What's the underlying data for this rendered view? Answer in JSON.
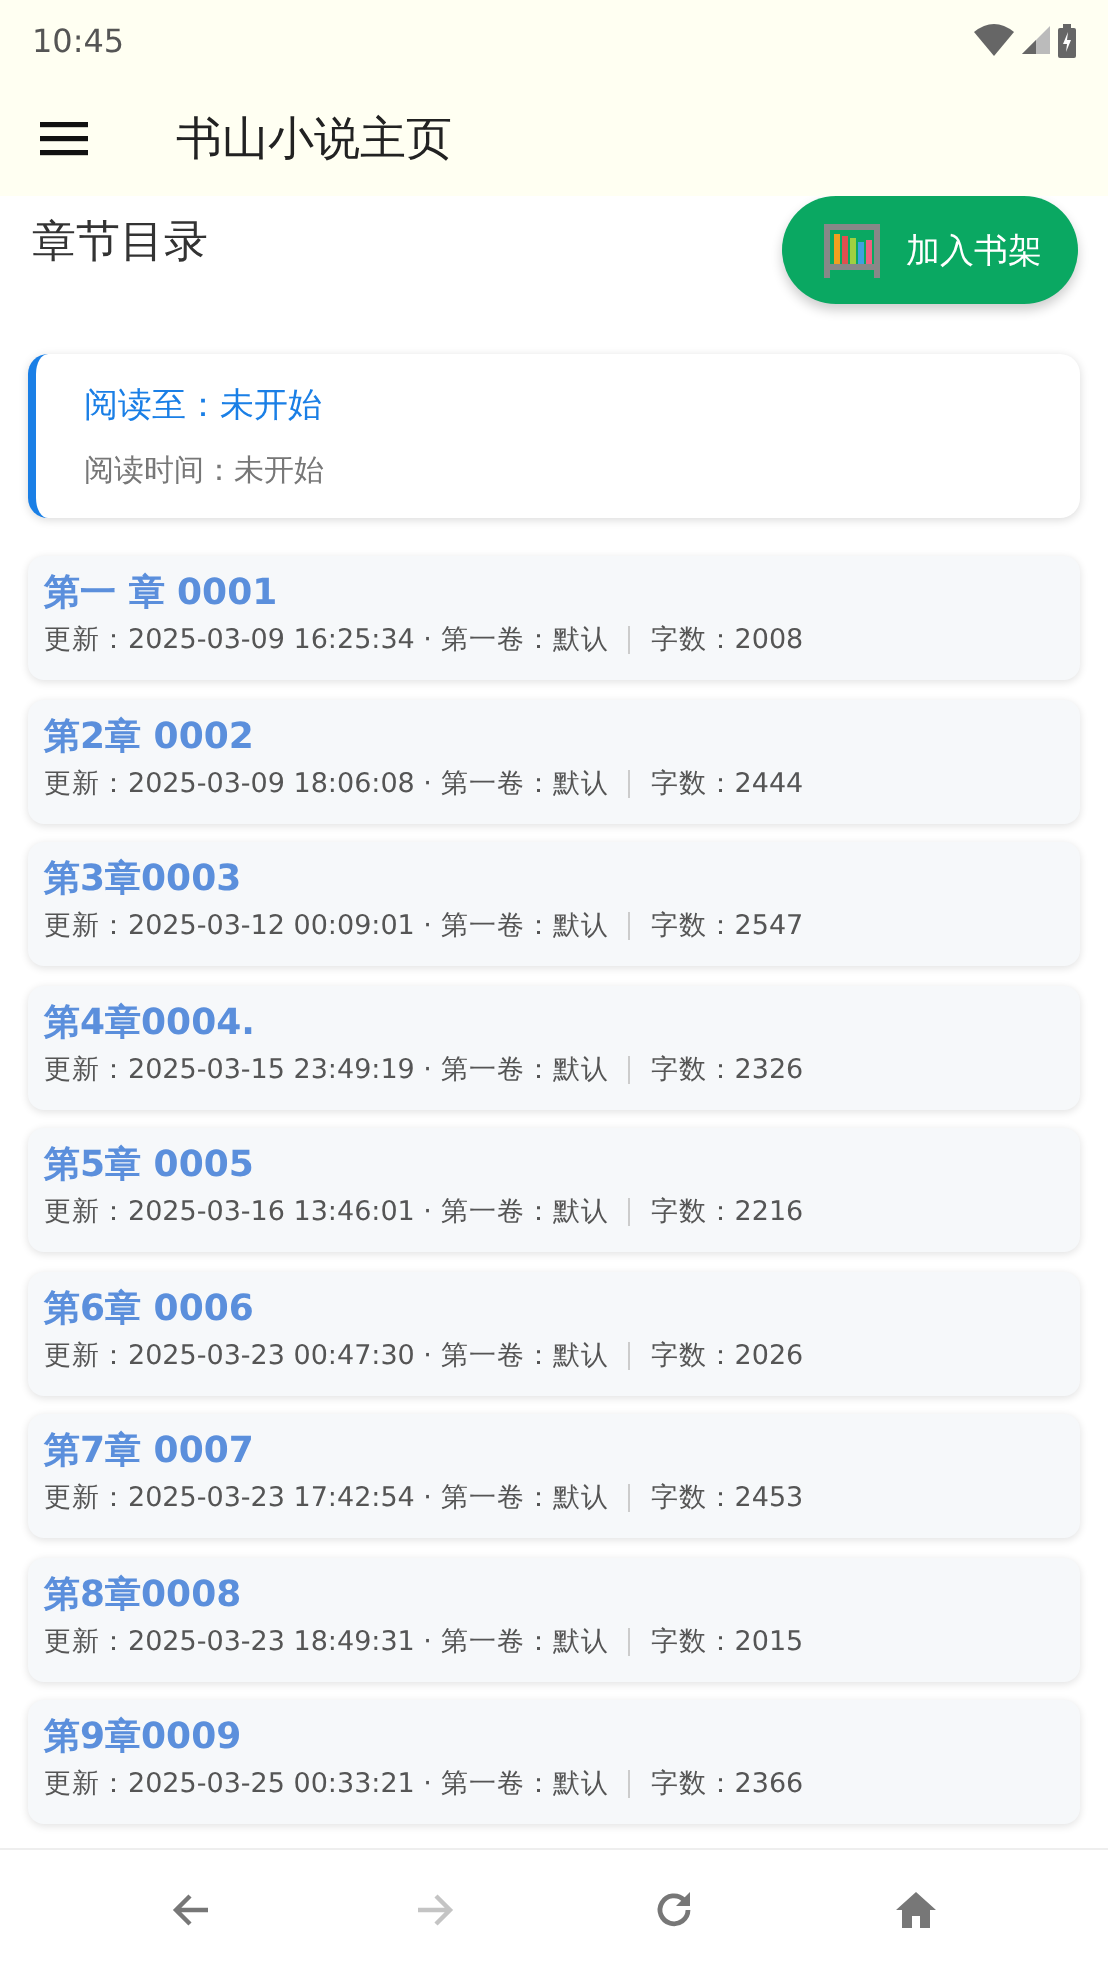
{
  "status_bar": {
    "time": "10:45"
  },
  "app_bar": {
    "title": "书山小说主页"
  },
  "heading": "章节目录",
  "shelf_button": {
    "label": "加入书架"
  },
  "reading": {
    "position": "阅读至：未开始",
    "time": "阅读时间：未开始"
  },
  "chapters": [
    {
      "title": "第一 章 0001",
      "meta": "更新：2025-03-09 16:25:34 · 第一卷：默认",
      "words": "字数：2008"
    },
    {
      "title": "第2章 0002",
      "meta": "更新：2025-03-09 18:06:08 · 第一卷：默认",
      "words": "字数：2444"
    },
    {
      "title": "第3章0003",
      "meta": "更新：2025-03-12 00:09:01 · 第一卷：默认",
      "words": "字数：2547"
    },
    {
      "title": "第4章0004.",
      "meta": "更新：2025-03-15 23:49:19 · 第一卷：默认",
      "words": "字数：2326"
    },
    {
      "title": "第5章 0005",
      "meta": "更新：2025-03-16 13:46:01 · 第一卷：默认",
      "words": "字数：2216"
    },
    {
      "title": "第6章 0006",
      "meta": "更新：2025-03-23 00:47:30 · 第一卷：默认",
      "words": "字数：2026"
    },
    {
      "title": "第7章 0007",
      "meta": "更新：2025-03-23 17:42:54 · 第一卷：默认",
      "words": "字数：2453"
    },
    {
      "title": "第8章0008",
      "meta": "更新：2025-03-23 18:49:31 · 第一卷：默认",
      "words": "字数：2015"
    },
    {
      "title": "第9章0009",
      "meta": "更新：2025-03-25 00:33:21 · 第一卷：默认",
      "words": "字数：2366"
    }
  ],
  "nav": [
    {
      "kind": "back",
      "disabled": false
    },
    {
      "kind": "forward",
      "disabled": true
    },
    {
      "kind": "reload",
      "disabled": false
    },
    {
      "kind": "home",
      "disabled": false
    }
  ]
}
